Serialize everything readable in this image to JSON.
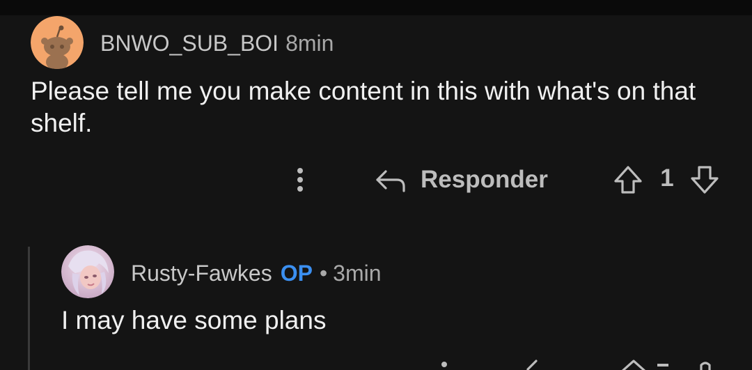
{
  "comments": [
    {
      "username": "BNWO_SUB_BOI",
      "time": "8min",
      "body": "Please tell me you make content in this with what's on that shelf.",
      "reply_label": "Responder",
      "vote_count": "1",
      "avatar_icon": "snoo-avatar-icon",
      "avatar_bg": "#f4a56b"
    },
    {
      "username": "Rusty-Fawkes",
      "badge": "OP",
      "separator": "•",
      "time": "3min",
      "body": "I may have some plans",
      "avatar_icon": "user-avatar-icon"
    }
  ],
  "colors": {
    "background": "#141414",
    "op_badge": "#3b8ff0",
    "muted_text": "#a9a9a9",
    "icon": "#bdbdbd"
  }
}
